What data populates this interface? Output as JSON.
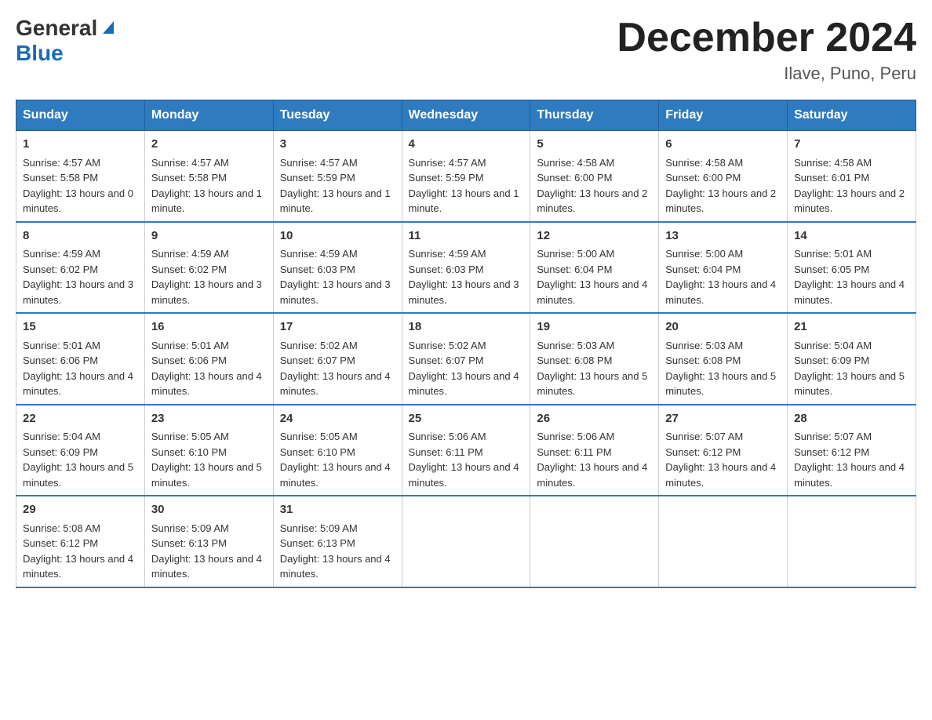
{
  "header": {
    "logo": {
      "general": "General",
      "blue": "Blue",
      "triangle": true
    },
    "title": "December 2024",
    "location": "Ilave, Puno, Peru"
  },
  "calendar": {
    "days_of_week": [
      "Sunday",
      "Monday",
      "Tuesday",
      "Wednesday",
      "Thursday",
      "Friday",
      "Saturday"
    ],
    "weeks": [
      [
        {
          "day": "1",
          "sunrise": "4:57 AM",
          "sunset": "5:58 PM",
          "daylight": "13 hours and 0 minutes."
        },
        {
          "day": "2",
          "sunrise": "4:57 AM",
          "sunset": "5:58 PM",
          "daylight": "13 hours and 1 minute."
        },
        {
          "day": "3",
          "sunrise": "4:57 AM",
          "sunset": "5:59 PM",
          "daylight": "13 hours and 1 minute."
        },
        {
          "day": "4",
          "sunrise": "4:57 AM",
          "sunset": "5:59 PM",
          "daylight": "13 hours and 1 minute."
        },
        {
          "day": "5",
          "sunrise": "4:58 AM",
          "sunset": "6:00 PM",
          "daylight": "13 hours and 2 minutes."
        },
        {
          "day": "6",
          "sunrise": "4:58 AM",
          "sunset": "6:00 PM",
          "daylight": "13 hours and 2 minutes."
        },
        {
          "day": "7",
          "sunrise": "4:58 AM",
          "sunset": "6:01 PM",
          "daylight": "13 hours and 2 minutes."
        }
      ],
      [
        {
          "day": "8",
          "sunrise": "4:59 AM",
          "sunset": "6:02 PM",
          "daylight": "13 hours and 3 minutes."
        },
        {
          "day": "9",
          "sunrise": "4:59 AM",
          "sunset": "6:02 PM",
          "daylight": "13 hours and 3 minutes."
        },
        {
          "day": "10",
          "sunrise": "4:59 AM",
          "sunset": "6:03 PM",
          "daylight": "13 hours and 3 minutes."
        },
        {
          "day": "11",
          "sunrise": "4:59 AM",
          "sunset": "6:03 PM",
          "daylight": "13 hours and 3 minutes."
        },
        {
          "day": "12",
          "sunrise": "5:00 AM",
          "sunset": "6:04 PM",
          "daylight": "13 hours and 4 minutes."
        },
        {
          "day": "13",
          "sunrise": "5:00 AM",
          "sunset": "6:04 PM",
          "daylight": "13 hours and 4 minutes."
        },
        {
          "day": "14",
          "sunrise": "5:01 AM",
          "sunset": "6:05 PM",
          "daylight": "13 hours and 4 minutes."
        }
      ],
      [
        {
          "day": "15",
          "sunrise": "5:01 AM",
          "sunset": "6:06 PM",
          "daylight": "13 hours and 4 minutes."
        },
        {
          "day": "16",
          "sunrise": "5:01 AM",
          "sunset": "6:06 PM",
          "daylight": "13 hours and 4 minutes."
        },
        {
          "day": "17",
          "sunrise": "5:02 AM",
          "sunset": "6:07 PM",
          "daylight": "13 hours and 4 minutes."
        },
        {
          "day": "18",
          "sunrise": "5:02 AM",
          "sunset": "6:07 PM",
          "daylight": "13 hours and 4 minutes."
        },
        {
          "day": "19",
          "sunrise": "5:03 AM",
          "sunset": "6:08 PM",
          "daylight": "13 hours and 5 minutes."
        },
        {
          "day": "20",
          "sunrise": "5:03 AM",
          "sunset": "6:08 PM",
          "daylight": "13 hours and 5 minutes."
        },
        {
          "day": "21",
          "sunrise": "5:04 AM",
          "sunset": "6:09 PM",
          "daylight": "13 hours and 5 minutes."
        }
      ],
      [
        {
          "day": "22",
          "sunrise": "5:04 AM",
          "sunset": "6:09 PM",
          "daylight": "13 hours and 5 minutes."
        },
        {
          "day": "23",
          "sunrise": "5:05 AM",
          "sunset": "6:10 PM",
          "daylight": "13 hours and 5 minutes."
        },
        {
          "day": "24",
          "sunrise": "5:05 AM",
          "sunset": "6:10 PM",
          "daylight": "13 hours and 4 minutes."
        },
        {
          "day": "25",
          "sunrise": "5:06 AM",
          "sunset": "6:11 PM",
          "daylight": "13 hours and 4 minutes."
        },
        {
          "day": "26",
          "sunrise": "5:06 AM",
          "sunset": "6:11 PM",
          "daylight": "13 hours and 4 minutes."
        },
        {
          "day": "27",
          "sunrise": "5:07 AM",
          "sunset": "6:12 PM",
          "daylight": "13 hours and 4 minutes."
        },
        {
          "day": "28",
          "sunrise": "5:07 AM",
          "sunset": "6:12 PM",
          "daylight": "13 hours and 4 minutes."
        }
      ],
      [
        {
          "day": "29",
          "sunrise": "5:08 AM",
          "sunset": "6:12 PM",
          "daylight": "13 hours and 4 minutes."
        },
        {
          "day": "30",
          "sunrise": "5:09 AM",
          "sunset": "6:13 PM",
          "daylight": "13 hours and 4 minutes."
        },
        {
          "day": "31",
          "sunrise": "5:09 AM",
          "sunset": "6:13 PM",
          "daylight": "13 hours and 4 minutes."
        },
        null,
        null,
        null,
        null
      ]
    ]
  }
}
